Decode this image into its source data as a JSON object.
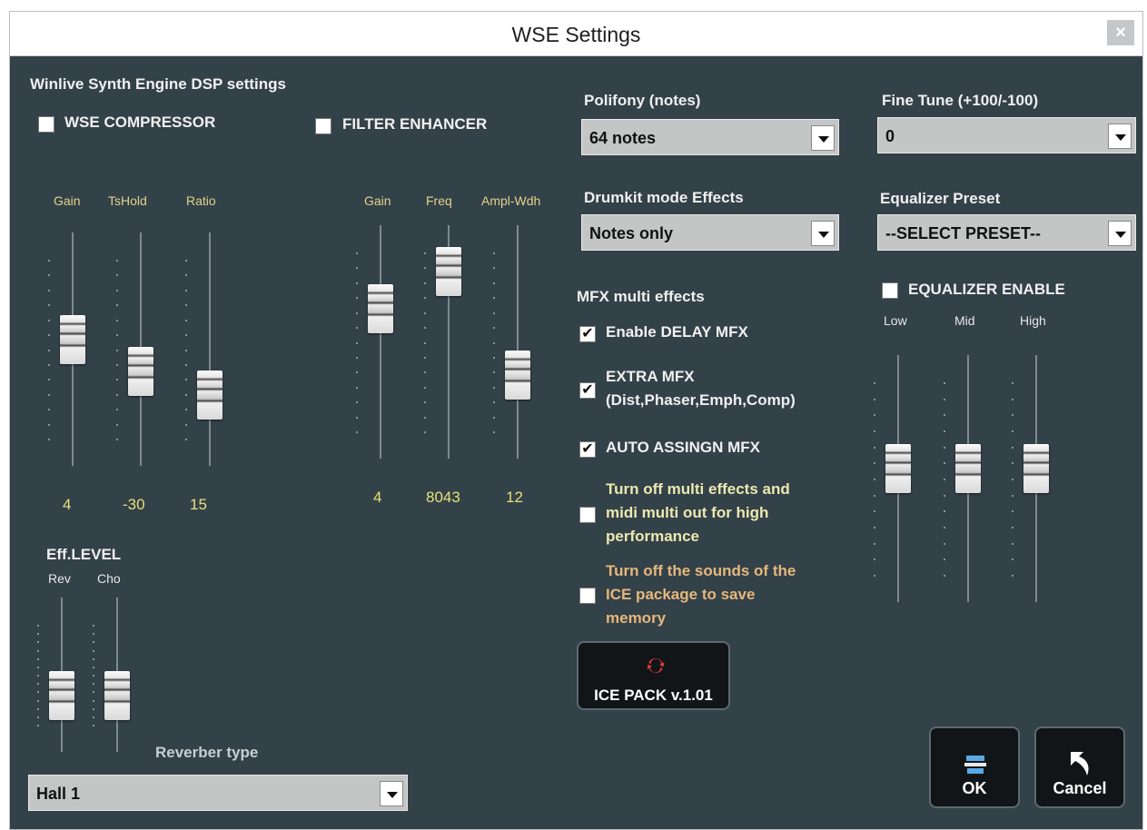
{
  "window": {
    "title": "WSE Settings",
    "close_label": "×"
  },
  "heading": "Winlive Synth Engine DSP settings",
  "compressor": {
    "label": "WSE COMPRESSOR",
    "checked": false,
    "sliders": [
      {
        "name": "Gain",
        "value": "4",
        "level": 0.55
      },
      {
        "name": "TsHold",
        "value": "-30",
        "level": 0.38
      },
      {
        "name": "Ratio",
        "value": "15",
        "level": 0.25
      }
    ]
  },
  "filter": {
    "label": "FILTER ENHANCER",
    "checked": false,
    "sliders": [
      {
        "name": "Gain",
        "value": "4",
        "level": 0.68
      },
      {
        "name": "Freq",
        "value": "8043",
        "level": 0.88
      },
      {
        "name": "Ampl-Wdh",
        "value": "12",
        "level": 0.32
      }
    ]
  },
  "eff_level": {
    "label": "Eff.LEVEL",
    "sliders": [
      {
        "name": "Rev",
        "level": 0.3
      },
      {
        "name": "Cho",
        "level": 0.3
      }
    ]
  },
  "reverb": {
    "label": "Reverber type",
    "value": "Hall 1"
  },
  "polifony": {
    "label": "Polifony (notes)",
    "value": "64 notes"
  },
  "drumkit": {
    "label": "Drumkit mode Effects",
    "value": "Notes only"
  },
  "mfx": {
    "label": "MFX multi effects",
    "options": [
      {
        "label": "Enable DELAY MFX",
        "checked": true
      },
      {
        "label": "EXTRA MFX\n(Dist,Phaser,Emph,Comp)",
        "checked": true
      },
      {
        "label": "AUTO ASSINGN MFX",
        "checked": true
      },
      {
        "label": "Turn off multi effects and\nmidi multi out for high\nperformance",
        "checked": false
      },
      {
        "label": "Turn off the sounds of the\nICE package to save\nmemory",
        "checked": false
      }
    ]
  },
  "ice_pack": {
    "label": "ICE PACK v.1.01"
  },
  "fine_tune": {
    "label": "Fine Tune (+100/-100)",
    "value": "0"
  },
  "equalizer": {
    "preset_label": "Equalizer Preset",
    "preset_value": "--SELECT PRESET--",
    "enable_label": "EQUALIZER ENABLE",
    "enabled": false,
    "bands": [
      {
        "name": "Low",
        "level": 0.55
      },
      {
        "name": "Mid",
        "level": 0.55
      },
      {
        "name": "High",
        "level": 0.55
      }
    ]
  },
  "buttons": {
    "ok": "OK",
    "cancel": "Cancel"
  },
  "colors": {
    "background": "#334148",
    "value_text": "#e5e07a",
    "slider_label": "#e0d48a"
  }
}
